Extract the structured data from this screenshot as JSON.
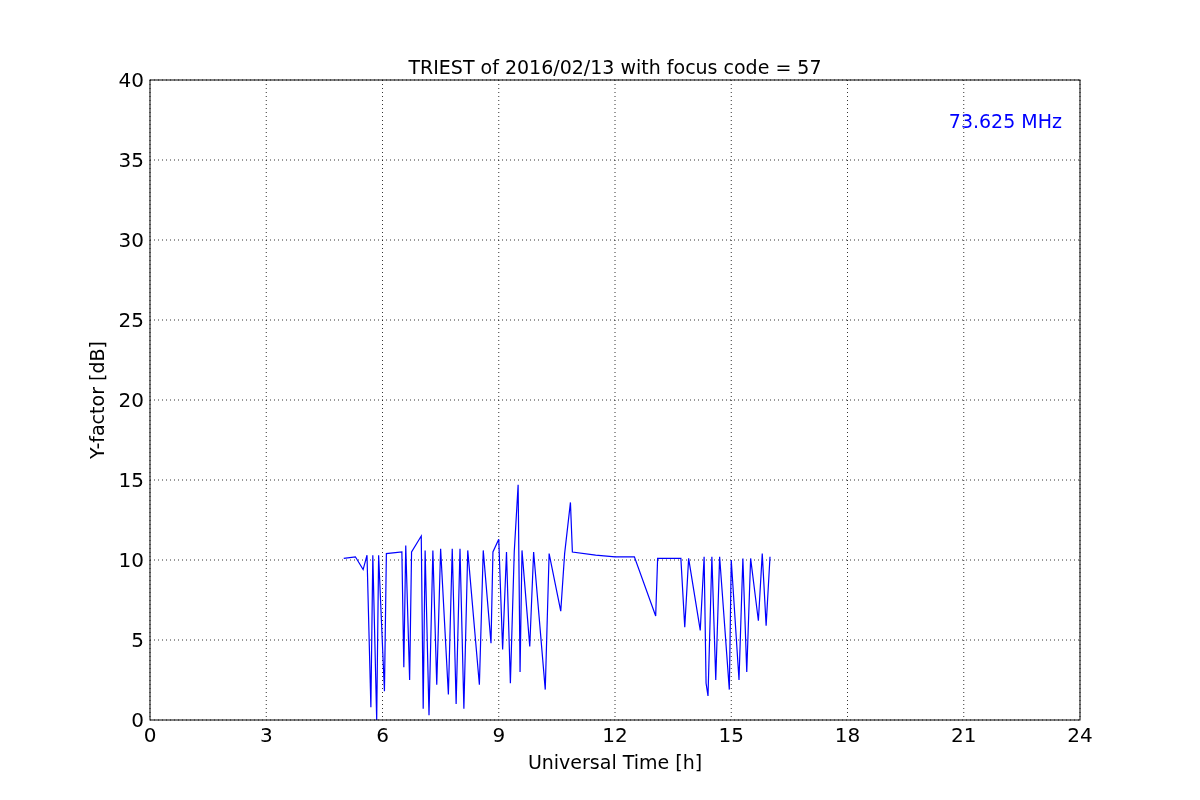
{
  "figure": {
    "chart_data": {
      "type": "line",
      "title": "TRIEST of 2016/02/13 with focus code = 57",
      "xlabel": "Universal Time [h]",
      "ylabel": "Y-factor [dB]",
      "xlim": [
        0,
        24
      ],
      "ylim": [
        0,
        40
      ],
      "xticks": [
        0,
        3,
        6,
        9,
        12,
        15,
        18,
        21,
        24
      ],
      "yticks": [
        0,
        5,
        10,
        15,
        20,
        25,
        30,
        35,
        40
      ],
      "x": [
        5.0,
        5.3,
        5.5,
        5.6,
        5.7,
        5.75,
        5.85,
        5.9,
        6.05,
        6.1,
        6.5,
        6.55,
        6.6,
        6.7,
        6.75,
        7.0,
        7.05,
        7.1,
        7.2,
        7.3,
        7.4,
        7.5,
        7.7,
        7.8,
        7.9,
        8.0,
        8.1,
        8.2,
        8.5,
        8.6,
        8.8,
        8.85,
        9.0,
        9.1,
        9.2,
        9.3,
        9.4,
        9.5,
        9.55,
        9.6,
        9.8,
        9.9,
        10.2,
        10.3,
        10.6,
        10.7,
        10.85,
        10.9,
        11.5,
        12.0,
        12.5,
        13.05,
        13.1,
        13.7,
        13.8,
        13.9,
        14.2,
        14.3,
        14.35,
        14.4,
        14.5,
        14.6,
        14.7,
        14.95,
        15.0,
        15.2,
        15.3,
        15.4,
        15.5,
        15.7,
        15.8,
        15.9,
        16.0
      ],
      "series": [
        {
          "color": "#0000ff",
          "values": [
            10.1,
            10.2,
            9.4,
            10.3,
            0.8,
            10.3,
            0.0,
            10.3,
            1.8,
            10.4,
            10.5,
            3.3,
            10.9,
            2.5,
            10.5,
            11.5,
            0.7,
            10.6,
            0.3,
            10.6,
            2.2,
            10.7,
            1.6,
            10.7,
            1.0,
            10.7,
            0.7,
            10.6,
            2.2,
            10.6,
            4.8,
            10.5,
            11.3,
            4.4,
            10.5,
            2.3,
            10.5,
            14.7,
            3.0,
            10.6,
            4.6,
            10.5,
            1.9,
            10.4,
            6.8,
            10.4,
            13.6,
            10.5,
            10.3,
            10.2,
            10.2,
            6.5,
            10.1,
            10.1,
            5.8,
            10.1,
            5.6,
            10.2,
            2.3,
            1.5,
            10.2,
            2.5,
            10.2,
            1.9,
            10.0,
            2.5,
            10.1,
            3.0,
            10.1,
            6.2,
            10.4,
            5.9,
            10.2
          ]
        }
      ],
      "grid": true,
      "annotations": [
        {
          "text": "73.625 MHz"
        }
      ]
    }
  }
}
